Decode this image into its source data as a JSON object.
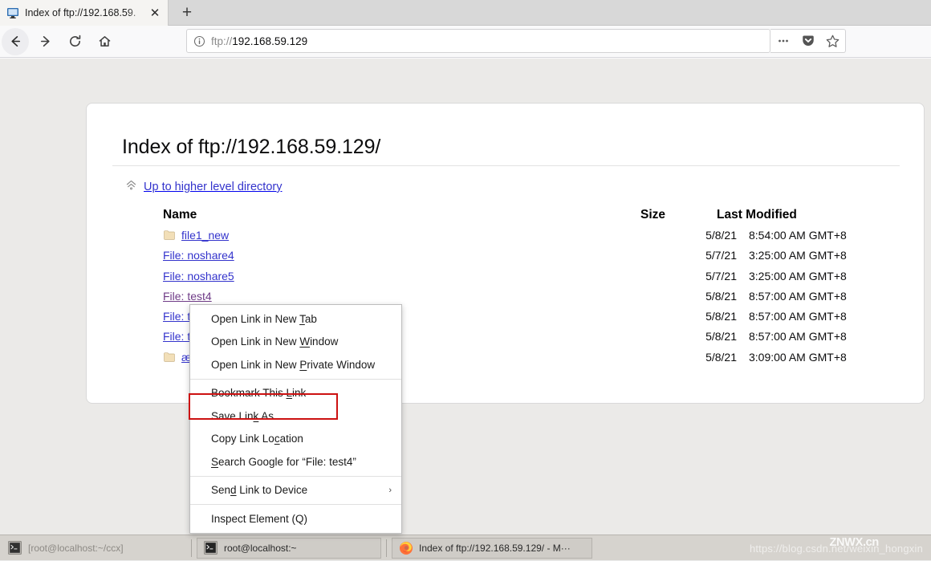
{
  "browser": {
    "tab": {
      "title": "Index of ftp://192.168.59.",
      "favicon_name": "monitor-icon",
      "close_label": "✕"
    },
    "newtab_label": "+",
    "nav": {
      "back_label": "←",
      "forward_label": "→",
      "reload_label": "↻",
      "home_label": "⌂"
    },
    "urlbar": {
      "scheme": "ftp://",
      "host": "192.168.59.129",
      "identity_icon": "info-circle-icon"
    },
    "actions": {
      "page_actions_label": "•••",
      "pocket_label": "pocket-icon",
      "bookmark_label": "star-icon"
    }
  },
  "page": {
    "title": "Index of ftp://192.168.59.129/",
    "up_directory": "Up to higher level directory",
    "up_icon": "up-chevrons-icon",
    "columns": {
      "name": "Name",
      "size": "Size",
      "last_modified": "Last Modified"
    },
    "rows": [
      {
        "name": "file1_new",
        "is_dir": true,
        "visited": false,
        "size": "",
        "date": "5/8/21",
        "time": "8:54:00 AM GMT+8"
      },
      {
        "name": "File: noshare4",
        "is_dir": false,
        "visited": false,
        "size": "",
        "date": "5/7/21",
        "time": "3:25:00 AM GMT+8"
      },
      {
        "name": "File: noshare5",
        "is_dir": false,
        "visited": false,
        "size": "",
        "date": "5/7/21",
        "time": "3:25:00 AM GMT+8"
      },
      {
        "name": "File: test4",
        "is_dir": false,
        "visited": true,
        "size": "",
        "date": "5/8/21",
        "time": "8:57:00 AM GMT+8"
      },
      {
        "name": "File: t",
        "is_dir": false,
        "visited": false,
        "size": "",
        "date": "5/8/21",
        "time": "8:57:00 AM GMT+8"
      },
      {
        "name": "File: t",
        "is_dir": false,
        "visited": false,
        "size": "",
        "date": "5/8/21",
        "time": "8:57:00 AM GMT+8"
      },
      {
        "name": "æ",
        "is_dir": true,
        "visited": false,
        "size": "",
        "date": "5/8/21",
        "time": "3:09:00 AM GMT+8"
      }
    ]
  },
  "context_menu": {
    "highlight_color": "#cc1111",
    "items": [
      {
        "label": "Open Link in New Tab",
        "accel": "T",
        "separator_after": false,
        "submenu": false
      },
      {
        "label": "Open Link in New Window",
        "accel": "W",
        "separator_after": false,
        "submenu": false
      },
      {
        "label": "Open Link in New Private Window",
        "accel": "P",
        "separator_after": true,
        "submenu": false
      },
      {
        "label": "Bookmark This Link",
        "accel": "L",
        "separator_after": false,
        "submenu": false
      },
      {
        "label": "Save Link As…",
        "accel": "k",
        "separator_after": false,
        "submenu": false
      },
      {
        "label": "Copy Link Location",
        "accel": "c",
        "separator_after": false,
        "submenu": false
      },
      {
        "label": "Search Google for “File: test4”",
        "accel": "S",
        "separator_after": true,
        "submenu": false
      },
      {
        "label": "Send Link to Device",
        "accel": "d",
        "separator_after": true,
        "submenu": true,
        "submenu_arrow": "›"
      },
      {
        "label": "Inspect Element (Q)",
        "accel": "",
        "separator_after": false,
        "submenu": false
      }
    ]
  },
  "taskbar": {
    "items": [
      {
        "label": "[root@localhost:~/ccx]",
        "icon": "terminal-icon",
        "active": false,
        "dim": true
      },
      {
        "label": "root@localhost:~",
        "icon": "terminal-icon",
        "active": true,
        "dim": false
      },
      {
        "label": "Index of ftp://192.168.59.129/ - M···",
        "icon": "firefox-icon",
        "active": true,
        "dim": false
      }
    ],
    "watermark_url": "https://blog.csdn.net/weixin_hongxin",
    "watermark_brand": "ZNWX.cn"
  }
}
